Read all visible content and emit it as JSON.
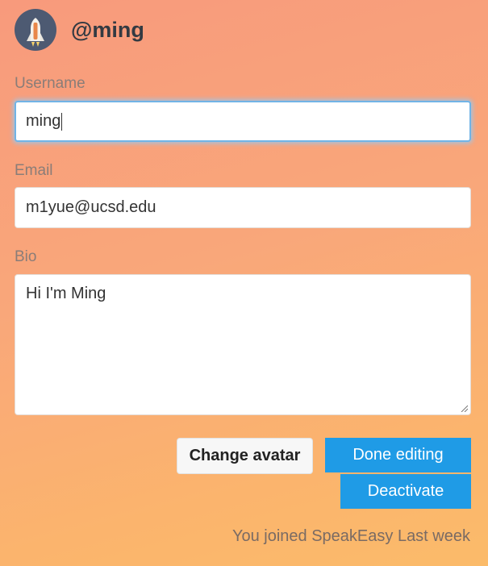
{
  "profile": {
    "handle": "@ming",
    "avatar_icon": "space-shuttle-icon",
    "avatar_bg": "#4d5a72"
  },
  "form": {
    "username_label": "Username",
    "username_value": "ming",
    "email_label": "Email",
    "email_value": "m1yue@ucsd.edu",
    "bio_label": "Bio",
    "bio_value": "Hi I'm Ming"
  },
  "actions": {
    "change_avatar": "Change avatar",
    "done_editing": "Done editing",
    "deactivate": "Deactivate"
  },
  "footer": {
    "joined_text": "You joined SpeakEasy Last week"
  },
  "colors": {
    "primary_button": "#1f9be6",
    "focus_ring": "#71b4e6"
  }
}
